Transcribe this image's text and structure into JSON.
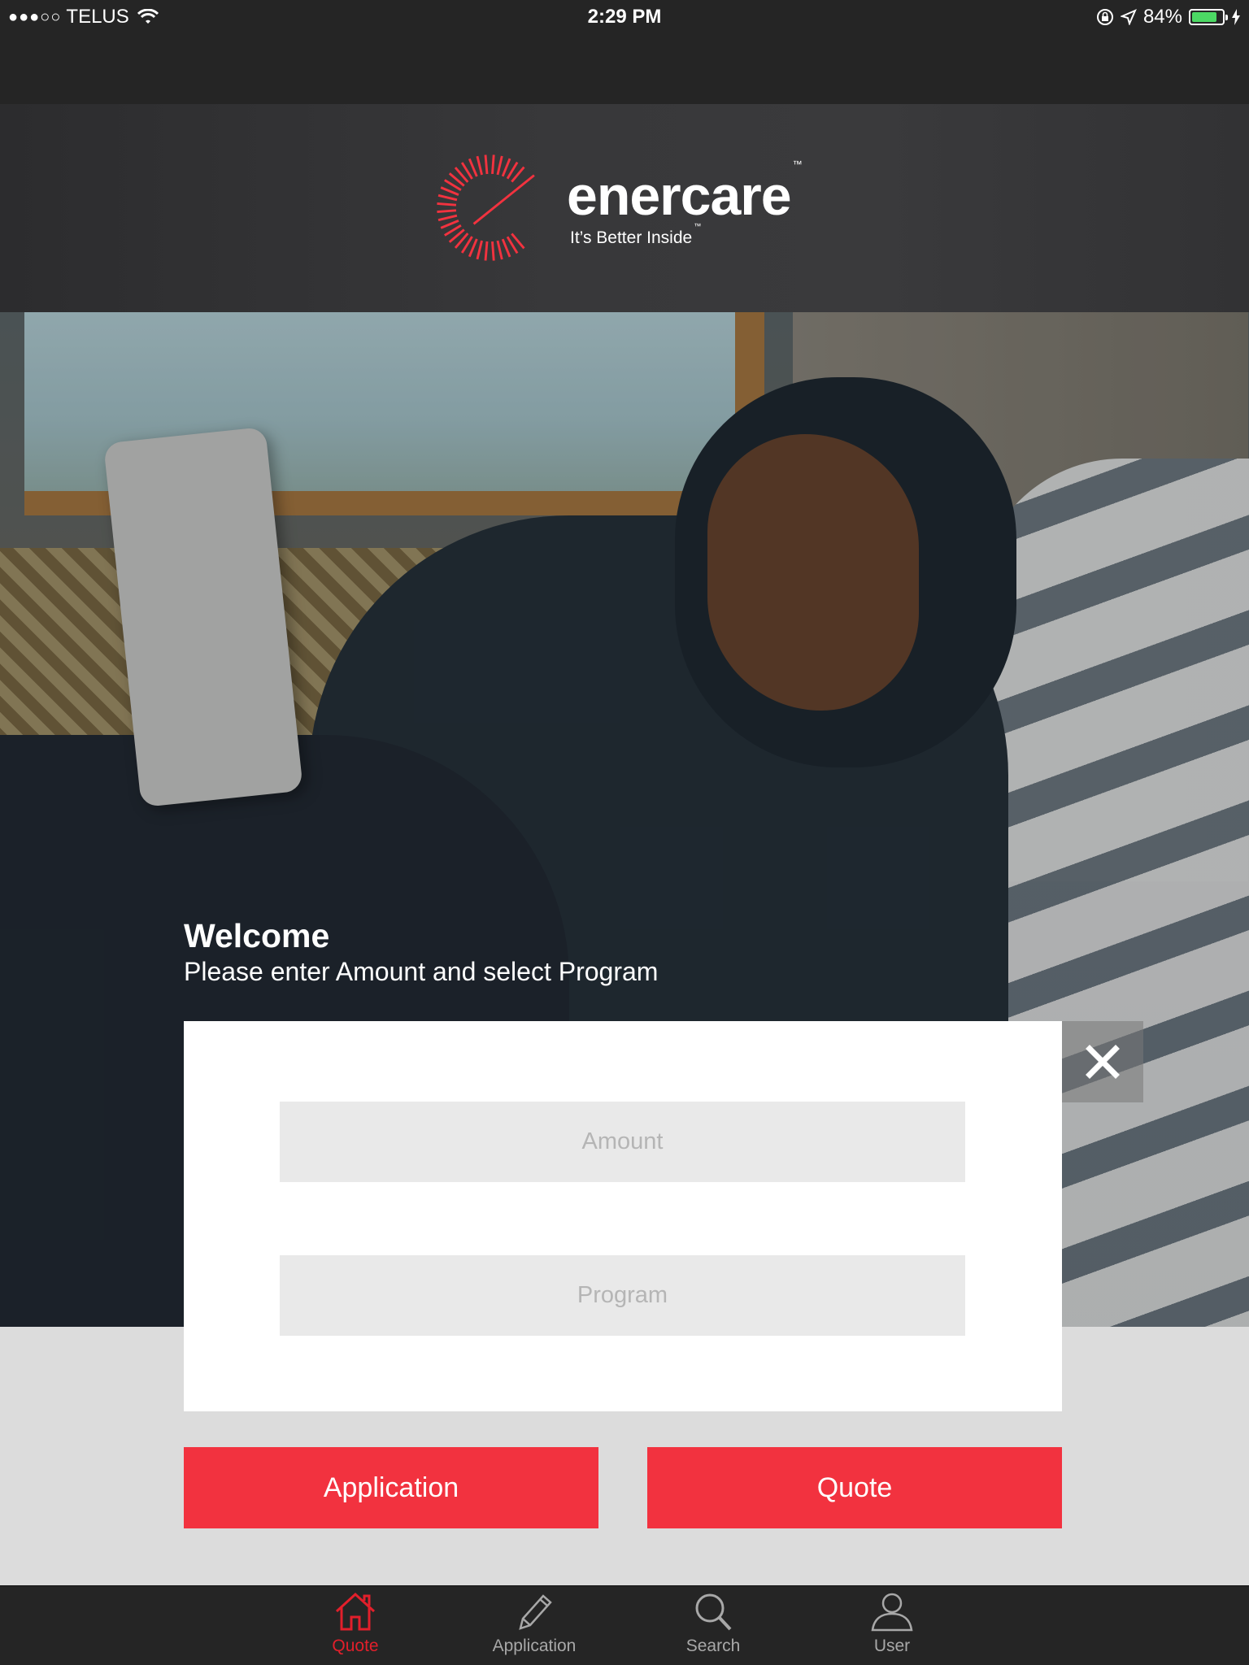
{
  "status_bar": {
    "signal": "●●●○○",
    "carrier": "TELUS",
    "time": "2:29 PM",
    "battery": "84%",
    "battery_level": 0.84
  },
  "brand": {
    "name": "enercare",
    "name_mark": "™",
    "tagline": "It’s Better Inside",
    "tagline_mark": "™",
    "accent_color": "#f2323f"
  },
  "welcome": {
    "title": "Welcome",
    "subtitle": "Please enter Amount and select Program"
  },
  "form": {
    "amount_placeholder": "Amount",
    "program_placeholder": "Program"
  },
  "actions": {
    "application_label": "Application",
    "quote_label": "Quote"
  },
  "tab_bar": {
    "items": [
      {
        "label": "Quote",
        "icon": "home-icon",
        "active": true
      },
      {
        "label": "Application",
        "icon": "pencil-icon",
        "active": false
      },
      {
        "label": "Search",
        "icon": "search-icon",
        "active": false
      },
      {
        "label": "User",
        "icon": "user-icon",
        "active": false
      }
    ],
    "active_color": "#e21f2b"
  }
}
